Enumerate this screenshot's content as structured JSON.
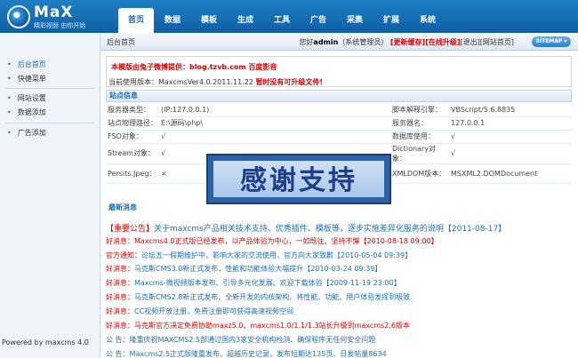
{
  "logo": {
    "text": "MaX",
    "sub": "精彩视频 由你开始"
  },
  "nav": [
    "首页",
    "数据",
    "模板",
    "生成",
    "工具",
    "广告",
    "采集",
    "扩展",
    "系统"
  ],
  "breadcrumb": "后台首页",
  "user": {
    "prefix": "您好",
    "name": "admin",
    "role": "（系统管理员）",
    "link_update": "[更新缓存]",
    "link_upgrade": "[在线升级]",
    "link_logout": "[退出]",
    "link_home": "[网站首页]",
    "sitemap": "SITEMAP"
  },
  "sidebar": {
    "items": [
      "后台首页",
      "快捷菜单",
      "网站设置",
      "数据添加",
      "广告添加"
    ],
    "powered": "Powered by maxcms 4.0"
  },
  "banner": {
    "line1": "本模版由兔子微博提供：blog.tzvb.com   百度影音",
    "line2_label": "当前使用版本：MaxcmsVer4.0.2011.11.22",
    "line2_alert": "暂时没有可升级文件!"
  },
  "site_info": {
    "title": "站点信息",
    "rows": [
      {
        "k1": "服务器类型：",
        "v1": "(IP:127.0.0.1)",
        "k2": "脚本解释引擎：",
        "v2": "VBScript/5.6.8835"
      },
      {
        "k1": "站点物理路径：",
        "v1": "E:\\源码\\php\\",
        "k2": "服务器名：",
        "v2": "127.0.0.1"
      },
      {
        "k1": "FSO对象：",
        "v1": "√",
        "k2": "数据库使用：",
        "v2": "√"
      },
      {
        "k1": "Stream对象：",
        "v1": "√",
        "k2": "Dictionary对象：",
        "v2": "√"
      },
      {
        "k1": "Persits.Jpeg：",
        "v1": "×",
        "k2": "XMLDOM版本：",
        "v2": "MSXML2.DOMDocument"
      }
    ]
  },
  "overlay": "感谢支持",
  "news": {
    "title": "最新消息",
    "items": [
      {
        "pfx": "【重要公告】",
        "text": "关于maxcms产品相关技术支持、优秀插件、模板等，逐步实施差异化服务的说明【2011-08-17】"
      },
      {
        "pfx": "好消息：",
        "text": "Maxcms4.0正式版已经发布，以产品体验为中心，一如既往、坚持不懈【2010-08-18 09:00】"
      },
      {
        "pfx": "官方通知：",
        "text": "论坛五一假期维护中，影响大家的交流使用，官方向大家致歉【2010-05-04 09:39】"
      },
      {
        "pfx": "好消息：",
        "text": "马克斯CMS3.0新正式发布，性能和功能体验大幅提升【2010-03-24 09:39】"
      },
      {
        "pfx": "好消息：",
        "text": "Maxcms-微视频版本发布、引导多元化发展、欢迎下载体验【2009-11-19 23:00】"
      },
      {
        "pfx": "好消息：",
        "text": "马克斯CMS2.8新正式发布、全新开发的内核架构、将性能、功能、用户体验发挥到极致"
      },
      {
        "pfx": "好消息：",
        "text": "CC视频开放注册，免费注册即可获得高速视频空间"
      },
      {
        "pfx": "好消息：",
        "text": "马克斯官方决定免费协助maxz5.0、maxcms1.0/1.1/1.3站长升级到maxcms2.6版本"
      },
      {
        "pfx": "公 告：",
        "text": "隆重庆祝MAXCMS2.5部通过国内3家安全机构检测、确保程序无任何安全问题"
      },
      {
        "pfx": "公 告：",
        "text": "Maxcms2.5正式版隆重发布、超越历史记录，发布短期达135页、日发帖量8634"
      }
    ]
  }
}
